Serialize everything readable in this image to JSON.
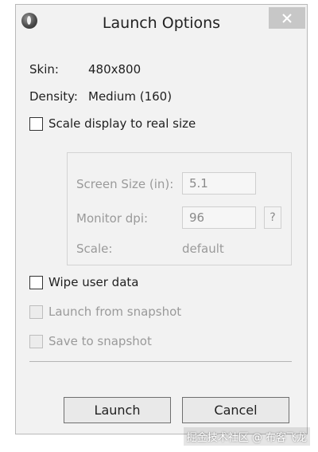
{
  "window": {
    "title": "Launch Options",
    "close_icon": "close-icon",
    "app_icon": "android-sdk-icon"
  },
  "info": {
    "skin_label": "Skin:",
    "skin_value": "480x800",
    "density_label": "Density:",
    "density_value": "Medium (160)"
  },
  "scale_display": {
    "label": "Scale display to real size",
    "checked": false
  },
  "scale_group": {
    "screen_size_label": "Screen Size (in):",
    "screen_size_value": "5.1",
    "monitor_dpi_label": "Monitor dpi:",
    "monitor_dpi_value": "96",
    "help_label": "?",
    "scale_label": "Scale:",
    "scale_value": "default"
  },
  "options": {
    "wipe_user_data": "Wipe user data",
    "launch_from_snapshot": "Launch from snapshot",
    "save_to_snapshot": "Save to snapshot"
  },
  "buttons": {
    "launch": "Launch",
    "cancel": "Cancel"
  },
  "watermark": "掘金技术社区 @ 布客飞龙"
}
